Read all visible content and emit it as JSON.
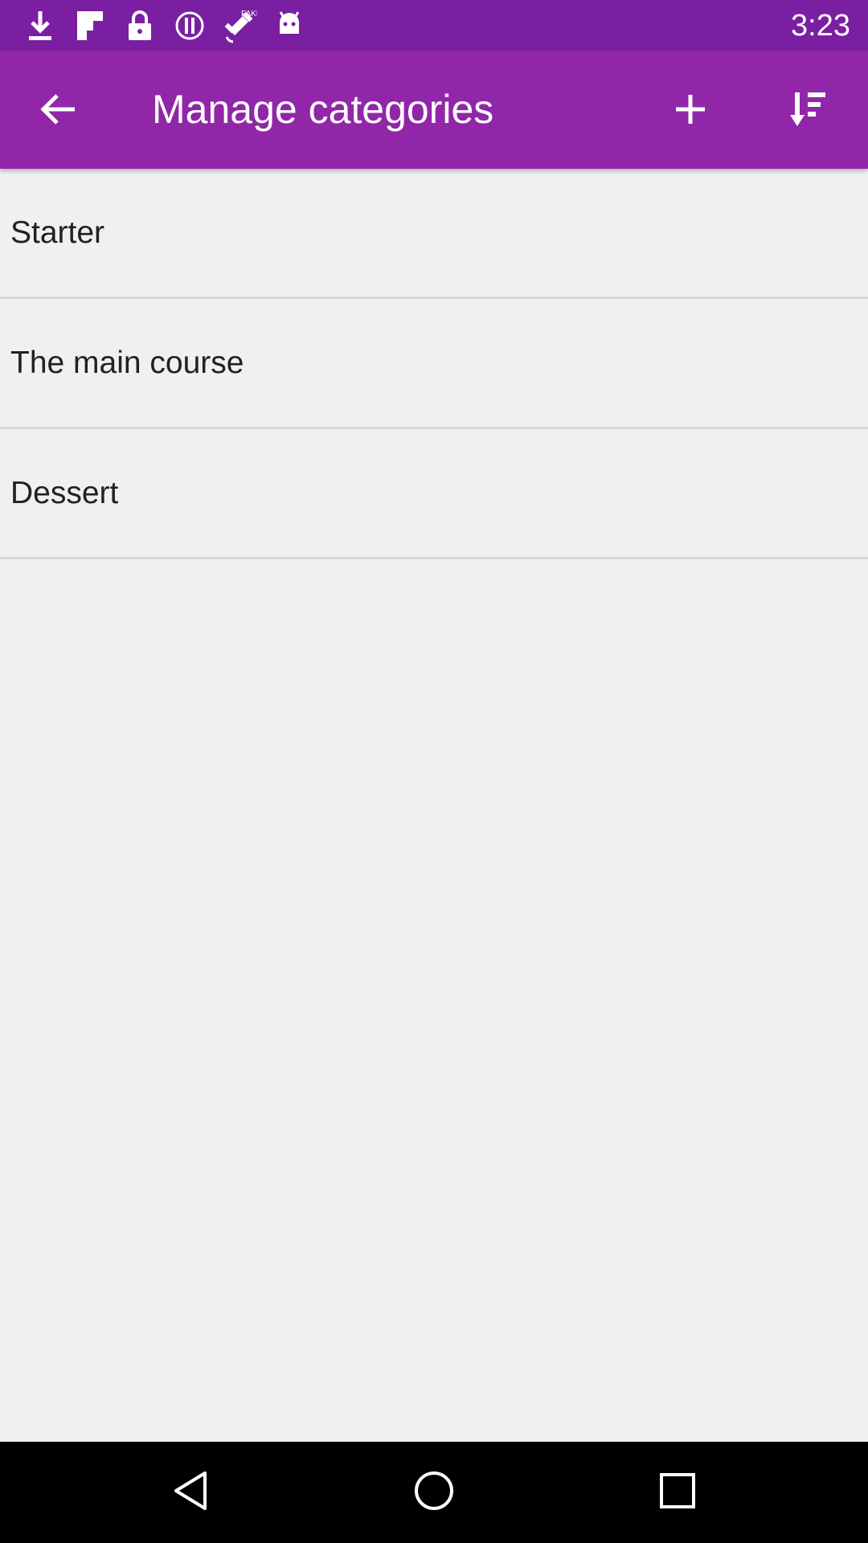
{
  "status_bar": {
    "time": "3:23",
    "icons": [
      "download-icon",
      "flipboard-icon",
      "lock-icon",
      "info-icon",
      "satellite-icon",
      "android-icon"
    ]
  },
  "app_bar": {
    "title": "Manage categories",
    "back_icon": "arrow-back-icon",
    "add_icon": "add-icon",
    "sort_icon": "sort-icon"
  },
  "categories": [
    {
      "label": "Starter"
    },
    {
      "label": "The main course"
    },
    {
      "label": "Dessert"
    }
  ],
  "nav_bar": {
    "icons": [
      "nav-back-icon",
      "nav-home-icon",
      "nav-recent-icon"
    ]
  },
  "colors": {
    "status_bar": "#7b1fa2",
    "app_bar": "#9126a9",
    "background": "#f0f0f0",
    "divider": "#d9d9d9"
  }
}
